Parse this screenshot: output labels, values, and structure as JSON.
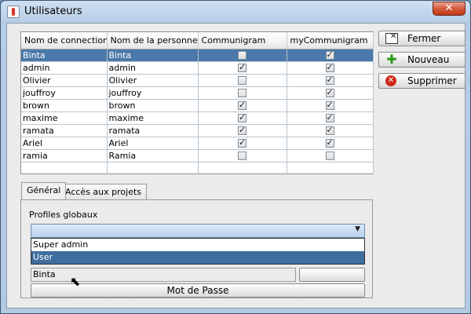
{
  "window": {
    "title": "Utilisateurs"
  },
  "table": {
    "headers": [
      "Nom de connection",
      "Nom de la personne",
      "Communigram",
      "myCommunigram"
    ],
    "rows": [
      {
        "login": "Binta",
        "name": "Binta",
        "communigram": false,
        "mycommunigram": true,
        "selected": true
      },
      {
        "login": "admin",
        "name": "admin",
        "communigram": true,
        "mycommunigram": true
      },
      {
        "login": "Olivier",
        "name": "Olivier",
        "communigram": false,
        "mycommunigram": true
      },
      {
        "login": "jouffroy",
        "name": "jouffroy",
        "communigram": false,
        "mycommunigram": true
      },
      {
        "login": "brown",
        "name": "brown",
        "communigram": true,
        "mycommunigram": true
      },
      {
        "login": "maxime",
        "name": "maxime",
        "communigram": true,
        "mycommunigram": true
      },
      {
        "login": "ramata",
        "name": "ramata",
        "communigram": true,
        "mycommunigram": true
      },
      {
        "login": "Ariel",
        "name": "Ariel",
        "communigram": true,
        "mycommunigram": true
      },
      {
        "login": "ramia",
        "name": "Ramia",
        "communigram": false,
        "mycommunigram": false
      }
    ]
  },
  "buttons": {
    "fermer": "Fermer",
    "nouveau": "Nouveau",
    "supprimer": "Supprimer"
  },
  "tabs": [
    {
      "label": "Général",
      "active": true
    },
    {
      "label": "Accès aux projets",
      "active": false
    }
  ],
  "general": {
    "profiles_label": "Profiles globaux",
    "combo_value": "",
    "options": [
      "Super admin",
      "User"
    ],
    "highlighted_option": "User",
    "name_field": "Binta",
    "password_button": "Mot de Passe"
  },
  "colors": {
    "selection": "#4b79a9",
    "close_button": "#c9482a"
  },
  "icons": {
    "close": "close-icon",
    "fermer": "window-close-icon",
    "nouveau": "plus-icon",
    "supprimer": "delete-icon"
  }
}
